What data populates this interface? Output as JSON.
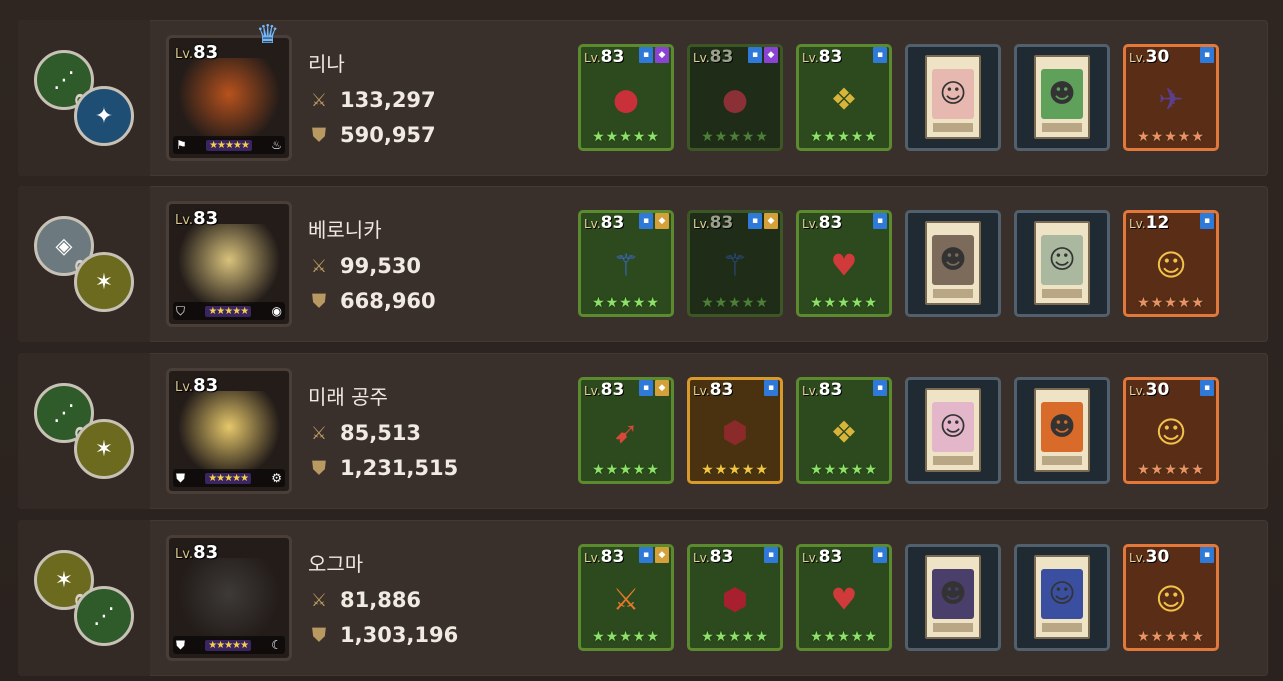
{
  "rows": [
    {
      "level": "83",
      "name": "리나",
      "attack": "133,297",
      "defense": "590,957",
      "crown": true,
      "chain_colors": [
        "#2f5a2a",
        "#1f4e75"
      ],
      "chain_icons": [
        "claw-icon",
        "wing-icon"
      ],
      "portrait_bg": "#b8521d",
      "class_icon": "bow-icon",
      "element_icon": "fire-icon",
      "slots": [
        {
          "kind": "green",
          "level": "83",
          "badges": [
            "b-blue",
            "b-purple"
          ],
          "icon": "ring-icon",
          "glyph": "●",
          "color": "#c9303a"
        },
        {
          "kind": "dim",
          "level": "83",
          "badges": [
            "b-blue",
            "b-purple"
          ],
          "icon": "ring-icon",
          "glyph": "●",
          "color": "#8a3036"
        },
        {
          "kind": "green",
          "level": "83",
          "badges": [
            "b-blue"
          ],
          "icon": "necklace-icon",
          "glyph": "❖",
          "color": "#d8b43a"
        },
        {
          "kind": "card",
          "level": "",
          "badges": [],
          "icon": "card-icon",
          "glyph": "☺",
          "color": "#e7b8b0"
        },
        {
          "kind": "card",
          "level": "",
          "badges": [],
          "icon": "card-icon",
          "glyph": "☻",
          "color": "#5fa05a"
        },
        {
          "kind": "orange",
          "level": "30",
          "badges": [
            "b-blue"
          ],
          "icon": "costume-icon",
          "glyph": "✈",
          "color": "#5b3f8a"
        }
      ]
    },
    {
      "level": "83",
      "name": "베로니카",
      "attack": "99,530",
      "defense": "668,960",
      "crown": false,
      "chain_colors": [
        "#6c7a80",
        "#6b6a1f"
      ],
      "chain_icons": [
        "rune-icon",
        "star-icon"
      ],
      "portrait_bg": "#d8c27c",
      "class_icon": "tank-icon",
      "element_icon": "water-icon",
      "slots": [
        {
          "kind": "green",
          "level": "83",
          "badges": [
            "b-blue",
            "b-gold"
          ],
          "icon": "staff-icon",
          "glyph": "⚚",
          "color": "#3a6bd8"
        },
        {
          "kind": "dim",
          "level": "83",
          "badges": [
            "b-blue",
            "b-gold"
          ],
          "icon": "staff-icon",
          "glyph": "⚚",
          "color": "#2b4e90"
        },
        {
          "kind": "green",
          "level": "83",
          "badges": [
            "b-blue"
          ],
          "icon": "necklace-icon",
          "glyph": "♥",
          "color": "#d03a3a"
        },
        {
          "kind": "card",
          "level": "",
          "badges": [],
          "icon": "card-icon",
          "glyph": "☻",
          "color": "#7c6a5a"
        },
        {
          "kind": "card",
          "level": "",
          "badges": [],
          "icon": "card-icon",
          "glyph": "☺",
          "color": "#a9b89e"
        },
        {
          "kind": "orange",
          "level": "12",
          "badges": [
            "b-blue"
          ],
          "icon": "costume-icon",
          "glyph": "☺",
          "color": "#f2c24a"
        }
      ]
    },
    {
      "level": "83",
      "name": "미래 공주",
      "attack": "85,513",
      "defense": "1,231,515",
      "crown": false,
      "chain_colors": [
        "#2f5a2a",
        "#6b6a1f"
      ],
      "chain_icons": [
        "claw-icon",
        "star-icon"
      ],
      "portrait_bg": "#e5c76a",
      "class_icon": "shield-icon",
      "element_icon": "gear-icon",
      "slots": [
        {
          "kind": "green",
          "level": "83",
          "badges": [
            "b-blue",
            "b-gold"
          ],
          "icon": "spear-icon",
          "glyph": "➹",
          "color": "#d8483a"
        },
        {
          "kind": "gold",
          "level": "83",
          "badges": [
            "b-blue"
          ],
          "icon": "armor-icon",
          "glyph": "⬢",
          "color": "#8a2a2a"
        },
        {
          "kind": "green",
          "level": "83",
          "badges": [
            "b-blue"
          ],
          "icon": "necklace-icon",
          "glyph": "❖",
          "color": "#d8b43a"
        },
        {
          "kind": "card",
          "level": "",
          "badges": [],
          "icon": "card-icon",
          "glyph": "☺",
          "color": "#e3b6c9"
        },
        {
          "kind": "card",
          "level": "",
          "badges": [],
          "icon": "card-icon",
          "glyph": "☻",
          "color": "#d86a2a"
        },
        {
          "kind": "orange",
          "level": "30",
          "badges": [
            "b-blue"
          ],
          "icon": "costume-icon",
          "glyph": "☺",
          "color": "#f2c24a"
        }
      ]
    },
    {
      "level": "83",
      "name": "오그마",
      "attack": "81,886",
      "defense": "1,303,196",
      "crown": false,
      "chain_colors": [
        "#6b6a1f",
        "#2f5a2a"
      ],
      "chain_icons": [
        "star-icon",
        "claw-icon"
      ],
      "portrait_bg": "#3d3a38",
      "class_icon": "shield-icon",
      "element_icon": "moon-icon",
      "slots": [
        {
          "kind": "green",
          "level": "83",
          "badges": [
            "b-blue",
            "b-gold"
          ],
          "icon": "sword-icon",
          "glyph": "⚔",
          "color": "#e2782a"
        },
        {
          "kind": "green",
          "level": "83",
          "badges": [
            "b-blue"
          ],
          "icon": "armor-icon",
          "glyph": "⬢",
          "color": "#a82030"
        },
        {
          "kind": "green",
          "level": "83",
          "badges": [
            "b-blue"
          ],
          "icon": "necklace-icon",
          "glyph": "♥",
          "color": "#d03a3a"
        },
        {
          "kind": "card",
          "level": "",
          "badges": [],
          "icon": "card-icon",
          "glyph": "☻",
          "color": "#4a3f6a"
        },
        {
          "kind": "card",
          "level": "",
          "badges": [],
          "icon": "card-icon",
          "glyph": "☺",
          "color": "#3a4fa0"
        },
        {
          "kind": "orange",
          "level": "30",
          "badges": [
            "b-blue"
          ],
          "icon": "costume-icon",
          "glyph": "☺",
          "color": "#f2c24a"
        }
      ]
    }
  ],
  "level_prefix": "Lv.",
  "stars_label": "★★★★★"
}
